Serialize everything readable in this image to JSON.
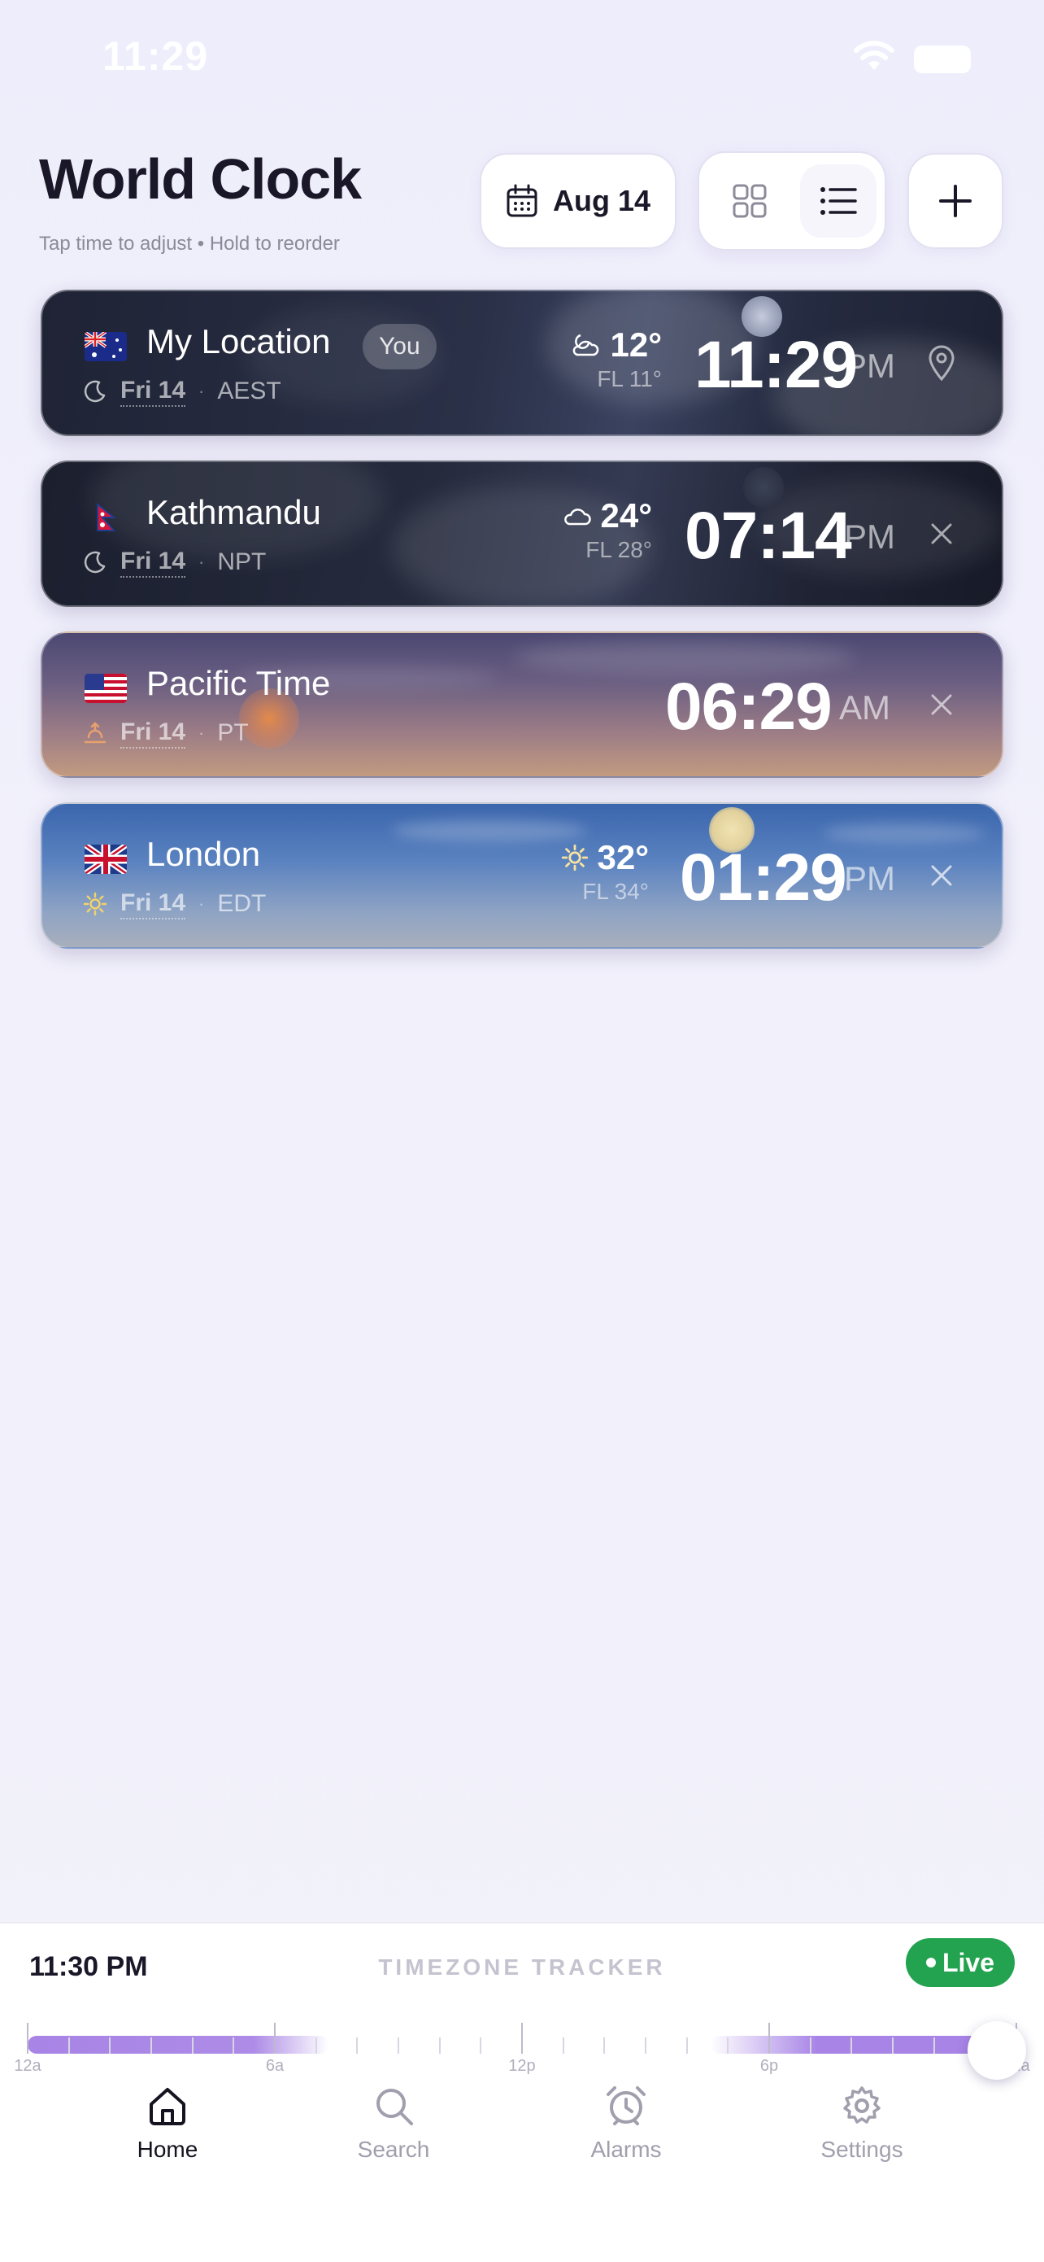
{
  "status_bar": {
    "time": "11:29"
  },
  "header": {
    "title": "World Clock",
    "subtitle": "Tap time to adjust • Hold to reorder",
    "date_button": "Aug 14",
    "view_mode": "list"
  },
  "cities": [
    {
      "name": "My Location",
      "badge": "You",
      "flag": "AU",
      "day": "Fri 14",
      "tz": "AEST",
      "day_icon": "moon-icon",
      "weather_icon": "partly-cloudy-night-icon",
      "temp": "12°",
      "feels_like": "FL 11°",
      "time": "11:29",
      "ampm": "PM",
      "action": "location-pin-icon",
      "theme": "night"
    },
    {
      "name": "Kathmandu",
      "flag": "NP",
      "day": "Fri 14",
      "tz": "NPT",
      "day_icon": "moon-icon",
      "weather_icon": "cloud-icon",
      "temp": "24°",
      "feels_like": "FL 28°",
      "time": "07:14",
      "ampm": "PM",
      "action": "close-icon",
      "theme": "night"
    },
    {
      "name": "Pacific Time",
      "flag": "US",
      "day": "Fri 14",
      "tz": "PT",
      "day_icon": "sunrise-icon",
      "time": "06:29",
      "ampm": "AM",
      "action": "close-icon",
      "theme": "dawn"
    },
    {
      "name": "London",
      "flag": "GB",
      "day": "Fri 14",
      "tz": "EDT",
      "day_icon": "sun-icon",
      "weather_icon": "sun-icon",
      "temp": "32°",
      "feels_like": "FL 34°",
      "time": "01:29",
      "ampm": "PM",
      "action": "close-icon",
      "theme": "day"
    }
  ],
  "tracker": {
    "current_time": "11:30 PM",
    "title": "TIMEZONE TRACKER",
    "live_label": "Live",
    "tick_labels": [
      "12a",
      "6a",
      "12p",
      "6p",
      "12a"
    ],
    "position_fraction": 0.98,
    "accent_color": "#a884e6"
  },
  "tabs": [
    {
      "label": "Home",
      "icon": "home-icon",
      "active": true
    },
    {
      "label": "Search",
      "icon": "search-icon",
      "active": false
    },
    {
      "label": "Alarms",
      "icon": "alarm-icon",
      "active": false
    },
    {
      "label": "Settings",
      "icon": "gear-icon",
      "active": false
    }
  ]
}
